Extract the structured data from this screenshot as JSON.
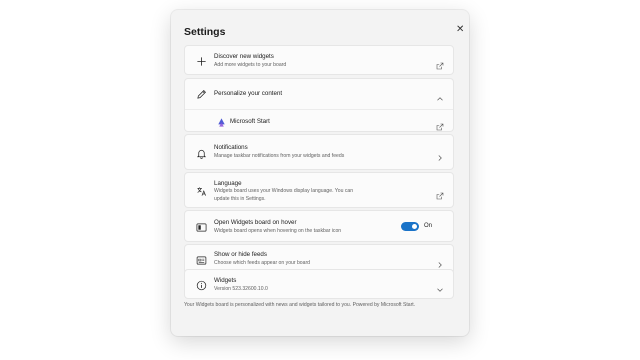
{
  "dialog": {
    "title": "Settings",
    "close_glyph": "✕"
  },
  "items": {
    "discover": {
      "title": "Discover new widgets",
      "desc": "Add more widgets to your board",
      "icon": "plus-icon",
      "action_icon": "external-link-icon"
    },
    "personalize": {
      "title": "Personalize your content",
      "icon": "pen-icon",
      "action_icon": "chevron-up-icon",
      "sub": {
        "title": "Microsoft Start",
        "icon": "microsoft-start-icon",
        "action_icon": "external-link-icon"
      }
    },
    "notifications": {
      "title": "Notifications",
      "desc": "Manage taskbar notifications from your widgets and feeds",
      "icon": "bell-icon",
      "action_icon": "chevron-right-icon"
    },
    "language": {
      "title": "Language",
      "desc_line1": "Widgets board uses your Windows display language. You can",
      "desc_line2": "update this in Settings.",
      "icon": "language-icon",
      "action_icon": "external-link-icon"
    },
    "hover": {
      "title": "Open Widgets board on hover",
      "desc": "Widgets board opens when hovering on the taskbar icon",
      "icon": "widgets-icon",
      "toggle_state": "On",
      "toggle_on": true
    },
    "feeds": {
      "title": "Show or hide feeds",
      "desc": "Choose which feeds appear on your board",
      "icon": "feeds-icon",
      "action_icon": "chevron-right-icon"
    },
    "widgets": {
      "title": "Widgets",
      "desc": "Version 523.32600.10.0",
      "icon": "info-icon",
      "action_icon": "chevron-down-icon"
    }
  },
  "footer": "Your Widgets board is personalized with news and widgets tailored to you. Powered by Microsoft Start.",
  "colors": {
    "accent": "#1a73c8",
    "panel_bg": "#f3f3f3",
    "card_bg": "#fbfbfb"
  }
}
